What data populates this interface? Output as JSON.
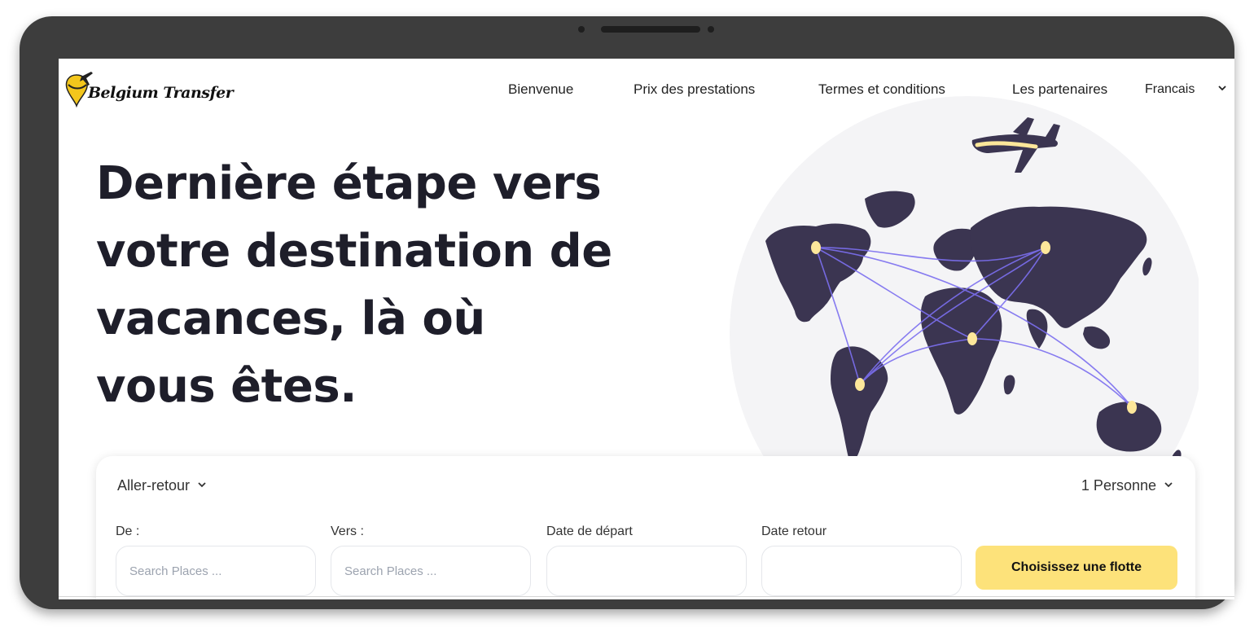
{
  "brand": {
    "name": "Belgium Transfer"
  },
  "nav": {
    "items": [
      {
        "label": "Bienvenue"
      },
      {
        "label": "Prix des prestations"
      },
      {
        "label": "Termes et conditions"
      },
      {
        "label": "Les partenaires"
      }
    ],
    "language": "Francais"
  },
  "hero": {
    "title": "Dernière étape vers votre destination de vacances, là où vous êtes."
  },
  "search": {
    "trip_type": "Aller-retour",
    "passengers": "1 Personne",
    "fields": [
      {
        "label": "De :",
        "placeholder": "Search Places ...",
        "value": ""
      },
      {
        "label": "Vers :",
        "placeholder": "Search Places ...",
        "value": ""
      },
      {
        "label": "Date de départ",
        "placeholder": "",
        "value": ""
      },
      {
        "label": "Date retour",
        "placeholder": "",
        "value": ""
      }
    ],
    "submit_label": "Choisissez une flotte"
  },
  "colors": {
    "accent": "#fde27a",
    "continent": "#3b3551",
    "route": "#7c6ff0",
    "city_dot": "#fde79a",
    "globe_bg": "#f4f4f6"
  }
}
